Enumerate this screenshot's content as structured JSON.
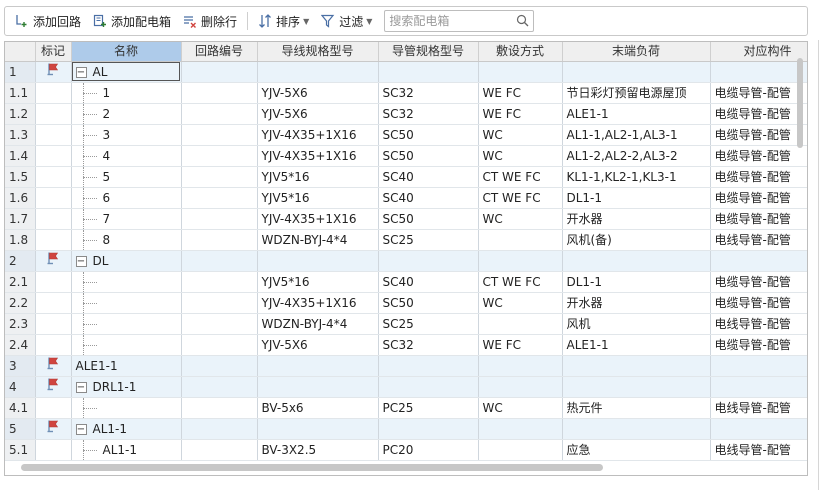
{
  "toolbar": {
    "add_circuit": "添加回路",
    "add_box": "添加配电箱",
    "delete_row": "删除行",
    "sort": "排序",
    "filter": "过滤",
    "search_placeholder": "搜索配电箱"
  },
  "colors": {
    "header_active": "#aecbea",
    "group_row": "#eaf3fa",
    "flag_red": "#d0443f",
    "flag_blue": "#6f8fb5"
  },
  "columns": [
    "标记",
    "名称",
    "回路编号",
    "导线规格型号",
    "导管规格型号",
    "敷设方式",
    "末端负荷",
    "对应构件"
  ],
  "rows": [
    {
      "idx": "1",
      "type": "group",
      "expander": "−",
      "name": "AL",
      "circuit": "",
      "wire": "",
      "pipe": "",
      "method": "",
      "load": "",
      "comp": "",
      "selected": true
    },
    {
      "idx": "1.1",
      "type": "child",
      "name": "1",
      "circuit": "",
      "wire": "YJV-5X6",
      "pipe": "SC32",
      "method": "WE FC",
      "load": "节日彩灯预留电源屋顶",
      "comp": "电缆导管-配管"
    },
    {
      "idx": "1.2",
      "type": "child",
      "name": "2",
      "circuit": "",
      "wire": "YJV-5X6",
      "pipe": "SC32",
      "method": "WE FC",
      "load": "ALE1-1",
      "comp": "电缆导管-配管"
    },
    {
      "idx": "1.3",
      "type": "child",
      "name": "3",
      "circuit": "",
      "wire": "YJV-4X35+1X16",
      "pipe": "SC50",
      "method": "WC",
      "load": "AL1-1,AL2-1,AL3-1",
      "comp": "电缆导管-配管"
    },
    {
      "idx": "1.4",
      "type": "child",
      "name": "4",
      "circuit": "",
      "wire": "YJV-4X35+1X16",
      "pipe": "SC50",
      "method": "WC",
      "load": "AL1-2,AL2-2,AL3-2",
      "comp": "电缆导管-配管"
    },
    {
      "idx": "1.5",
      "type": "child",
      "name": "5",
      "circuit": "",
      "wire": "YJV5*16",
      "pipe": "SC40",
      "method": "CT WE FC",
      "load": "KL1-1,KL2-1,KL3-1",
      "comp": "电缆导管-配管"
    },
    {
      "idx": "1.6",
      "type": "child",
      "name": "6",
      "circuit": "",
      "wire": "YJV5*16",
      "pipe": "SC40",
      "method": "CT WE FC",
      "load": "DL1-1",
      "comp": "电缆导管-配管"
    },
    {
      "idx": "1.7",
      "type": "child",
      "name": "7",
      "circuit": "",
      "wire": "YJV-4X35+1X16",
      "pipe": "SC50",
      "method": "WC",
      "load": "开水器",
      "comp": "电缆导管-配管"
    },
    {
      "idx": "1.8",
      "type": "child",
      "name": "8",
      "circuit": "",
      "wire": "WDZN-BYJ-4*4",
      "pipe": "SC25",
      "method": "",
      "load": "风机(备)",
      "comp": "电线导管-配管"
    },
    {
      "idx": "2",
      "type": "group",
      "expander": "−",
      "name": "DL",
      "circuit": "",
      "wire": "",
      "pipe": "",
      "method": "",
      "load": "",
      "comp": ""
    },
    {
      "idx": "2.1",
      "type": "child",
      "name": "",
      "circuit": "",
      "wire": "YJV5*16",
      "pipe": "SC40",
      "method": "CT WE FC",
      "load": "DL1-1",
      "comp": "电缆导管-配管"
    },
    {
      "idx": "2.2",
      "type": "child",
      "name": "",
      "circuit": "",
      "wire": "YJV-4X35+1X16",
      "pipe": "SC50",
      "method": "WC",
      "load": "开水器",
      "comp": "电缆导管-配管"
    },
    {
      "idx": "2.3",
      "type": "child",
      "name": "",
      "circuit": "",
      "wire": "WDZN-BYJ-4*4",
      "pipe": "SC25",
      "method": "",
      "load": "风机",
      "comp": "电线导管-配管"
    },
    {
      "idx": "2.4",
      "type": "child",
      "name": "",
      "circuit": "",
      "wire": "YJV-5X6",
      "pipe": "SC32",
      "method": "WE FC",
      "load": "ALE1-1",
      "comp": "电缆导管-配管"
    },
    {
      "idx": "3",
      "type": "group",
      "expander": "",
      "name": "ALE1-1",
      "circuit": "",
      "wire": "",
      "pipe": "",
      "method": "",
      "load": "",
      "comp": ""
    },
    {
      "idx": "4",
      "type": "group",
      "expander": "−",
      "name": "DRL1-1",
      "circuit": "",
      "wire": "",
      "pipe": "",
      "method": "",
      "load": "",
      "comp": ""
    },
    {
      "idx": "4.1",
      "type": "child",
      "name": "",
      "circuit": "",
      "wire": "BV-5x6",
      "pipe": "PC25",
      "method": "WC",
      "load": "热元件",
      "comp": "电线导管-配管"
    },
    {
      "idx": "5",
      "type": "group",
      "expander": "−",
      "name": "AL1-1",
      "circuit": "",
      "wire": "",
      "pipe": "",
      "method": "",
      "load": "",
      "comp": ""
    },
    {
      "idx": "5.1",
      "type": "child",
      "name": "AL1-1",
      "circuit": "",
      "wire": "BV-3X2.5",
      "pipe": "PC20",
      "method": "",
      "load": "应急",
      "comp": "电线导管-配管"
    }
  ]
}
